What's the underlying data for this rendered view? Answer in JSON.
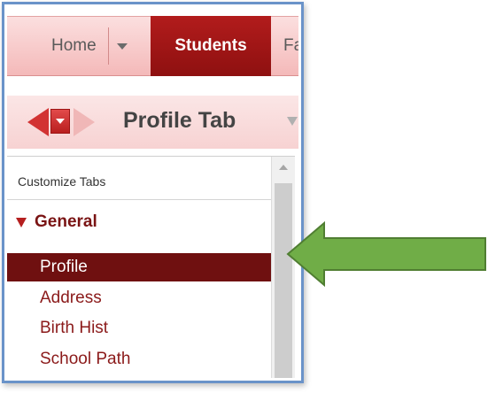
{
  "nav": {
    "home_label": "Home",
    "students_label": "Students",
    "next_label_partial": "Fa"
  },
  "header": {
    "title": "Profile Tab"
  },
  "tabs_panel": {
    "customize_label": "Customize Tabs",
    "group_label": "General",
    "items": [
      {
        "label": "Profile",
        "selected": true
      },
      {
        "label": "Address",
        "selected": false
      },
      {
        "label": "Birth Hist",
        "selected": false
      },
      {
        "label": "School Path",
        "selected": false
      }
    ]
  },
  "colors": {
    "frame_border": "#6a93c9",
    "active_tab": "#8e1010",
    "selected_item": "#6f1010",
    "link_text": "#8b1a1a",
    "pointer_arrow": "#70ad47"
  }
}
